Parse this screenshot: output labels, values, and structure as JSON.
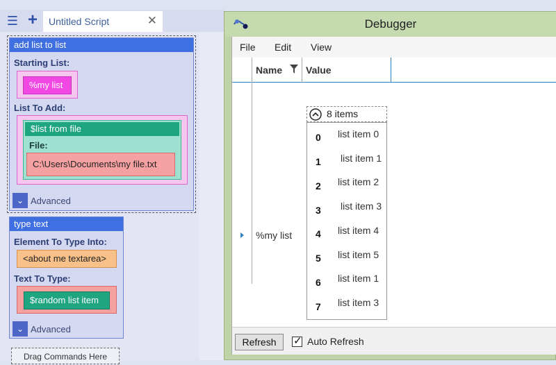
{
  "editor": {
    "tab_title": "Untitled Script",
    "menu_icon": "hamburger-icon",
    "add_icon": "plus-icon",
    "close_icon": "close-icon"
  },
  "commands": {
    "add_list": {
      "header": "add list to list",
      "starting_list_label": "Starting List:",
      "starting_list_value": "%my list",
      "list_to_add_label": "List To Add:",
      "list_from_file_header": "$list from file",
      "file_label": "File:",
      "file_value": "C:\\Users\\Documents\\my file.txt",
      "advanced_label": "Advanced"
    },
    "type_text": {
      "header": "type text",
      "element_label": "Element To Type Into:",
      "element_value": "<about me textarea>",
      "text_label": "Text To Type:",
      "text_value": "$random list item",
      "advanced_label": "Advanced"
    },
    "drag_hint": "Drag Commands Here"
  },
  "debugger": {
    "title": "Debugger",
    "menu": [
      "File",
      "Edit",
      "View"
    ],
    "columns": {
      "name": "Name",
      "value": "Value"
    },
    "variable": {
      "name": "%my list",
      "items_count": "8 items",
      "items": [
        {
          "index": "0",
          "value": "list item 0"
        },
        {
          "index": "1",
          "value": "list item 1"
        },
        {
          "index": "2",
          "value": "list item 2"
        },
        {
          "index": "3",
          "value": "list item 3"
        },
        {
          "index": "4",
          "value": "list item 4"
        },
        {
          "index": "5",
          "value": "list item 5"
        },
        {
          "index": "6",
          "value": "list item 1"
        },
        {
          "index": "7",
          "value": "list item 3"
        }
      ]
    },
    "refresh_label": "Refresh",
    "auto_refresh_label": "Auto Refresh",
    "auto_refresh_checked": true
  }
}
